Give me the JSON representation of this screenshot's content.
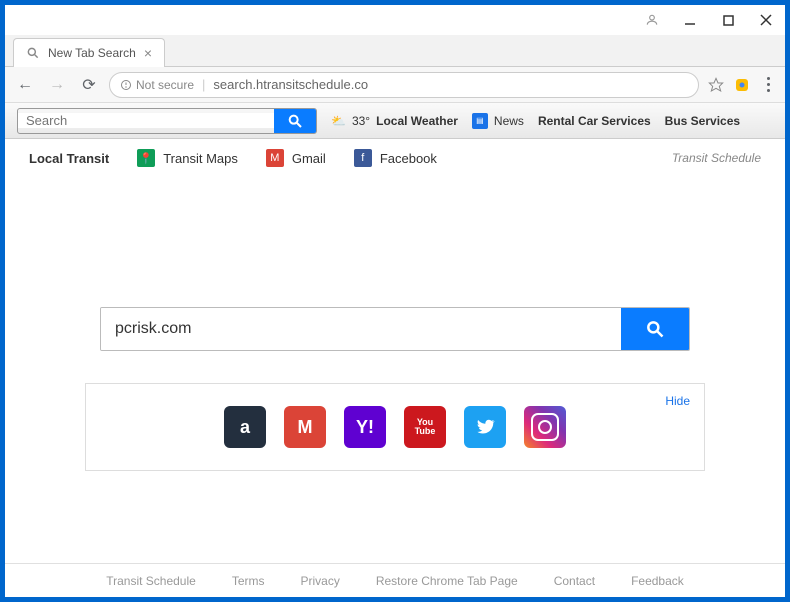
{
  "window": {
    "tab_title": "New Tab Search",
    "url_prefix": "Not secure",
    "url": "search.htransitschedule.co"
  },
  "toolbar": {
    "search_placeholder": "Search",
    "weather_temp": "33°",
    "weather_label": "Local Weather",
    "news_label": "News",
    "rental_label": "Rental Car Services",
    "bus_label": "Bus Services"
  },
  "quicklinks": {
    "local_transit": "Local Transit",
    "transit_maps": "Transit Maps",
    "gmail": "Gmail",
    "facebook": "Facebook",
    "brand": "Transit Schedule"
  },
  "main": {
    "search_value": "pcrisk.com",
    "hide_label": "Hide",
    "tiles": [
      {
        "name": "amazon"
      },
      {
        "name": "gmail"
      },
      {
        "name": "yahoo"
      },
      {
        "name": "youtube"
      },
      {
        "name": "twitter"
      },
      {
        "name": "instagram"
      }
    ]
  },
  "footer": {
    "items": [
      "Transit Schedule",
      "Terms",
      "Privacy",
      "Restore Chrome Tab Page",
      "Contact",
      "Feedback"
    ]
  }
}
